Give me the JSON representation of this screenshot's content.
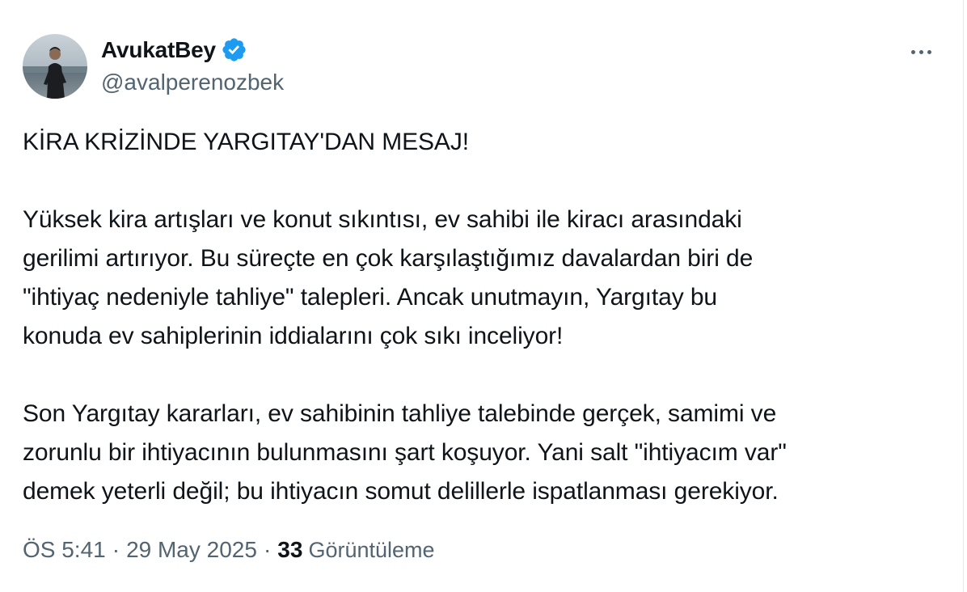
{
  "author": {
    "display_name": "AvukatBey",
    "handle": "@avalperenozbek",
    "verified": true,
    "verified_color": "#1d9bf0"
  },
  "actions": {
    "more_icon": "more-horizontal-icon"
  },
  "tweet": {
    "title_line": "KİRA KRİZİNDE YARGITAY'DAN MESAJ!",
    "paragraph1": [
      "Yüksek kira artışları ve konut sıkıntısı, ev sahibi ile kiracı arasındaki",
      "gerilimi artırıyor. Bu süreçte en çok karşılaştığımız davalardan biri de",
      "\"ihtiyaç nedeniyle tahliye\" talepleri. Ancak unutmayın, Yargıtay bu",
      "konuda ev sahiplerinin iddialarını çok sıkı inceliyor!"
    ],
    "paragraph2": [
      "Son Yargıtay kararları, ev sahibinin tahliye talebinde gerçek, samimi ve",
      "zorunlu bir ihtiyacının bulunmasını şart koşuyor. Yani salt \"ihtiyacım var\"",
      "demek yeterli değil; bu ihtiyacın somut delillerle ispatlanması gerekiyor."
    ]
  },
  "meta": {
    "time": "ÖS 5:41",
    "separator": "·",
    "date": "29 May 2025",
    "views_count": "33",
    "views_label": "Görüntüleme"
  }
}
